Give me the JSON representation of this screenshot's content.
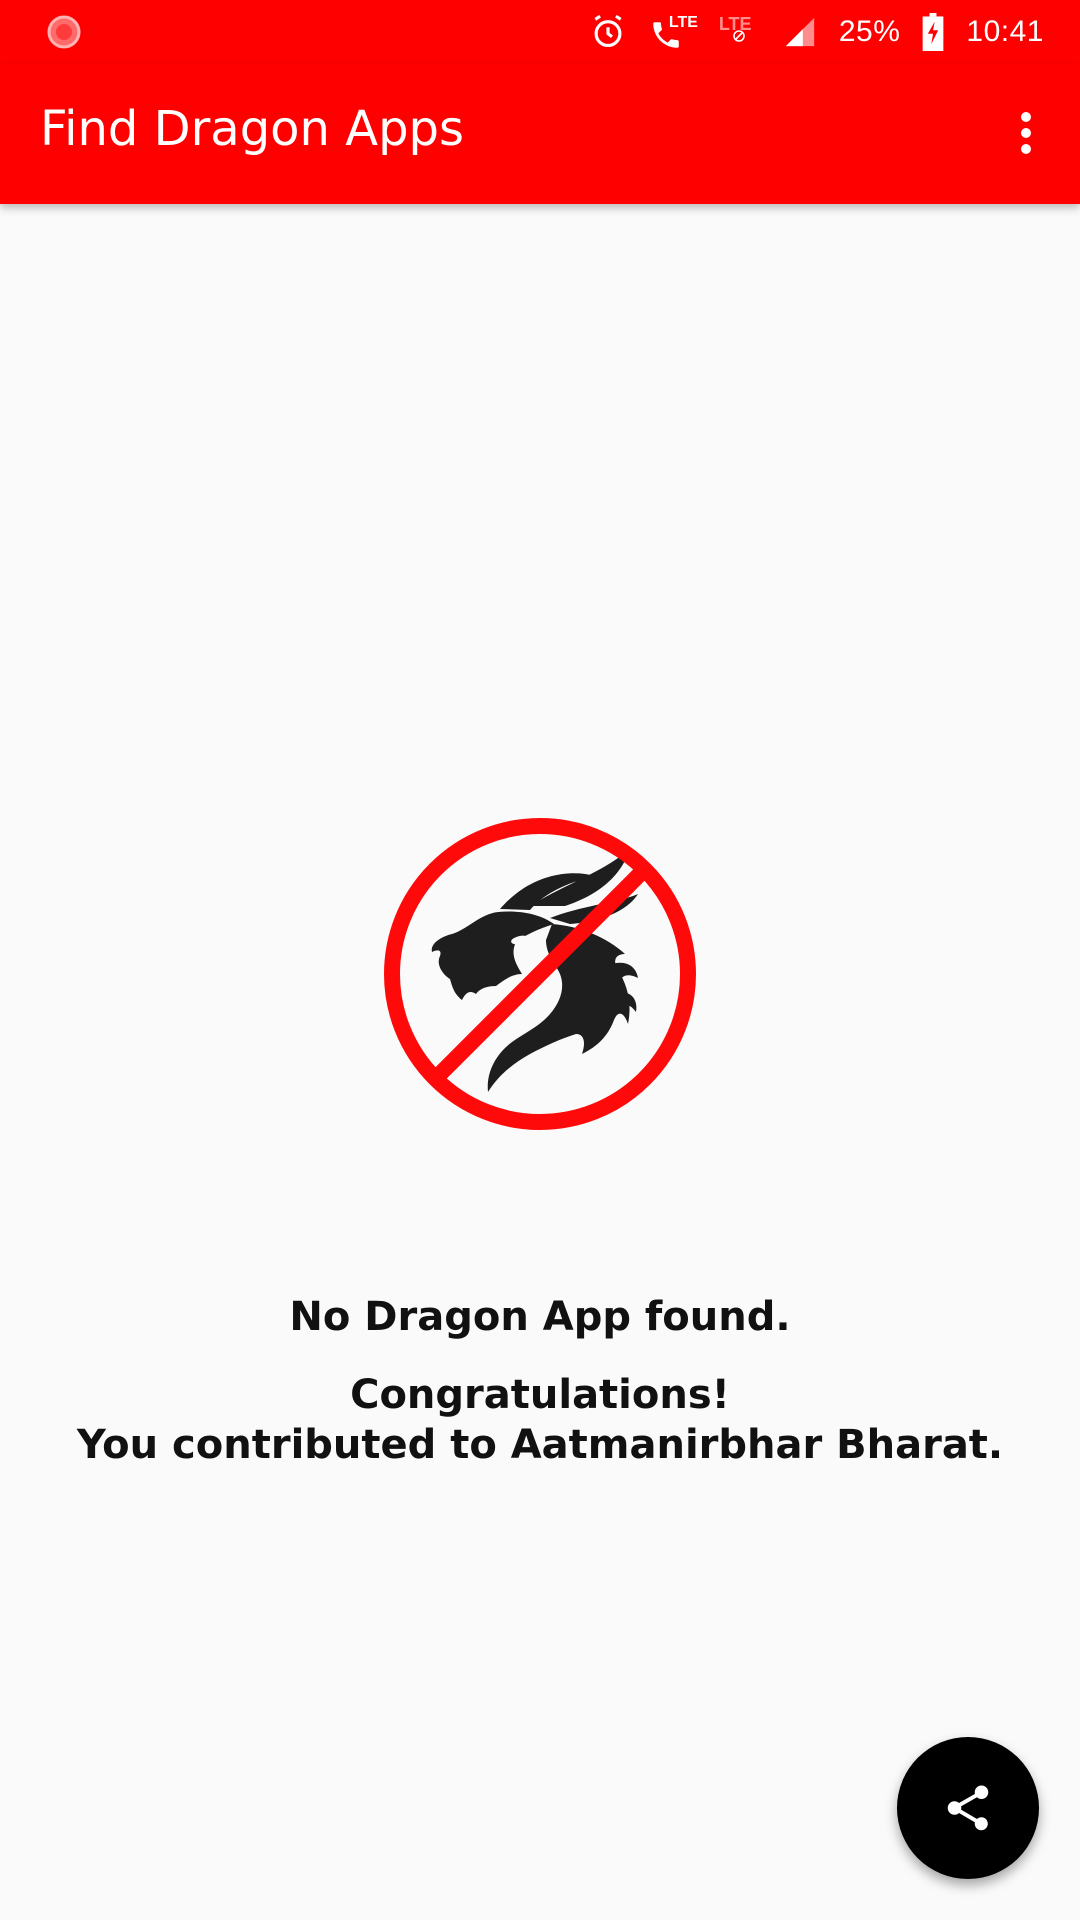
{
  "status_bar": {
    "battery_text": "25%",
    "time": "10:41",
    "lte_label_1": "LTE",
    "lte_label_2": "LTE",
    "icons": [
      "app-notification-icon",
      "alarm-icon",
      "volte-call-icon",
      "lte-data-off-icon",
      "signal-icon",
      "battery-charging-icon"
    ]
  },
  "app_bar": {
    "title": "Find Dragon Apps",
    "background_color": "#ff0000",
    "overflow_icon": "more-vert-icon"
  },
  "main": {
    "graphic_icon": "no-dragon-icon",
    "primary_message": "No Dragon App found.",
    "secondary_message_line1": "Congratulations!",
    "secondary_message_line2": "You contributed to Aatmanirbhar Bharat."
  },
  "fab": {
    "icon": "share-icon",
    "background_color": "#000000"
  }
}
